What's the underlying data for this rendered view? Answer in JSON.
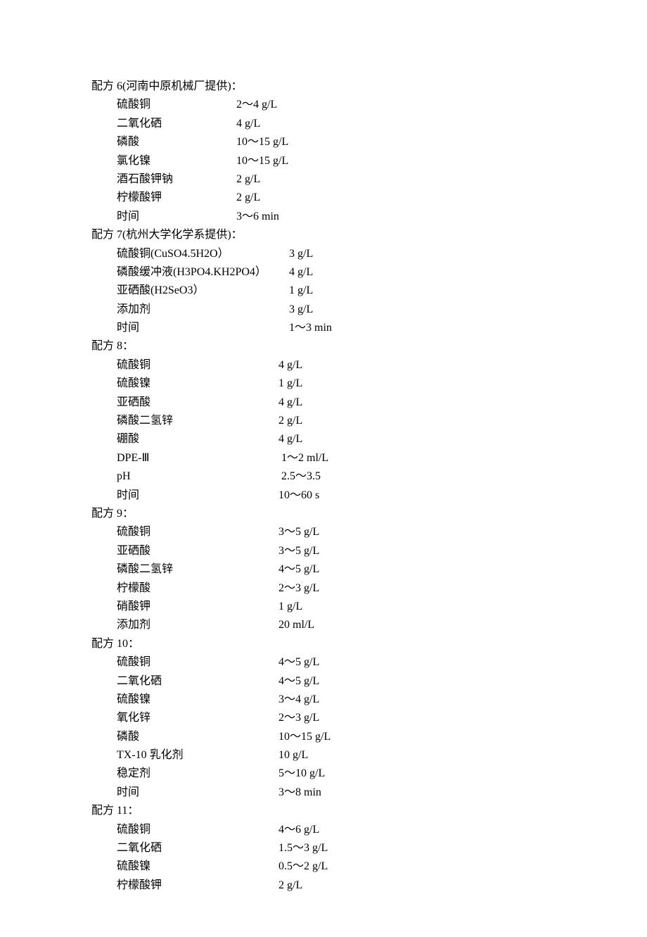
{
  "sections": [
    {
      "title": "配方 6(河南中原机械厂提供)：",
      "col": "col-a",
      "items": [
        {
          "label": "硫酸铜",
          "value": "2～4 g/L"
        },
        {
          "label": "二氧化硒",
          "value": "4 g/L"
        },
        {
          "label": "磷酸",
          "value": "10～15 g/L"
        },
        {
          "label": "氯化镍",
          "value": "10～15 g/L"
        },
        {
          "label": "酒石酸钾钠",
          "value": "2 g/L"
        },
        {
          "label": "柠檬酸钾",
          "value": "2 g/L"
        },
        {
          "label": "时间",
          "value": "3～6 min"
        }
      ]
    },
    {
      "title": "配方 7(杭州大学化学系提供)：",
      "col": "col-b",
      "items": [
        {
          "label": "硫酸铜(CuSO4.5H2O）",
          "value": "3 g/L"
        },
        {
          "label": "磷酸缓冲液(H3PO4.KH2PO4）",
          "value": "4 g/L"
        },
        {
          "label": "亚硒酸(H2SeO3）",
          "value": "1 g/L"
        },
        {
          "label": "添加剂",
          "value": "3 g/L"
        },
        {
          "label": "时间",
          "value": "1～3 min"
        }
      ]
    },
    {
      "title": "配方 8：",
      "col": "col-c",
      "items": [
        {
          "label": "硫酸铜",
          "value": "4 g/L"
        },
        {
          "label": "硫酸镍",
          "value": "1 g/L"
        },
        {
          "label": "亚硒酸",
          "value": "4 g/L"
        },
        {
          "label": "磷酸二氢锌",
          "value": "2 g/L"
        },
        {
          "label": "硼酸",
          "value": "4 g/L"
        },
        {
          "label": "DPE-Ⅲ",
          "value": " 1～2 ml/L"
        },
        {
          "label": "pH",
          "value": " 2.5～3.5"
        },
        {
          "label": "时间",
          "value": "10～60 s"
        }
      ]
    },
    {
      "title": "配方 9：",
      "col": "col-c",
      "items": [
        {
          "label": "硫酸铜",
          "value": "3～5 g/L"
        },
        {
          "label": "亚硒酸",
          "value": "3～5 g/L"
        },
        {
          "label": "磷酸二氢锌",
          "value": "4～5 g/L"
        },
        {
          "label": "柠檬酸",
          "value": "2～3 g/L"
        },
        {
          "label": "硝酸钾",
          "value": "1 g/L"
        },
        {
          "label": "添加剂",
          "value": "20 ml/L"
        }
      ]
    },
    {
      "title": "配方 10：",
      "col": "col-c",
      "items": [
        {
          "label": "硫酸铜",
          "value": "4～5 g/L"
        },
        {
          "label": "二氧化硒",
          "value": "4～5 g/L"
        },
        {
          "label": "硫酸镍",
          "value": "3～4 g/L"
        },
        {
          "label": "氧化锌",
          "value": "2～3 g/L"
        },
        {
          "label": "磷酸",
          "value": "10～15 g/L"
        },
        {
          "label": "TX-10 乳化剂",
          "value": "10 g/L"
        },
        {
          "label": "稳定剂",
          "value": "5～10 g/L"
        },
        {
          "label": "时间",
          "value": "3～8 min"
        }
      ]
    },
    {
      "title": "配方 11：",
      "col": "col-c",
      "items": [
        {
          "label": "硫酸铜",
          "value": "4～6 g/L"
        },
        {
          "label": "二氧化硒",
          "value": "1.5～3 g/L"
        },
        {
          "label": "硫酸镍",
          "value": "0.5～2 g/L"
        },
        {
          "label": "柠檬酸钾",
          "value": "2 g/L"
        }
      ]
    }
  ]
}
